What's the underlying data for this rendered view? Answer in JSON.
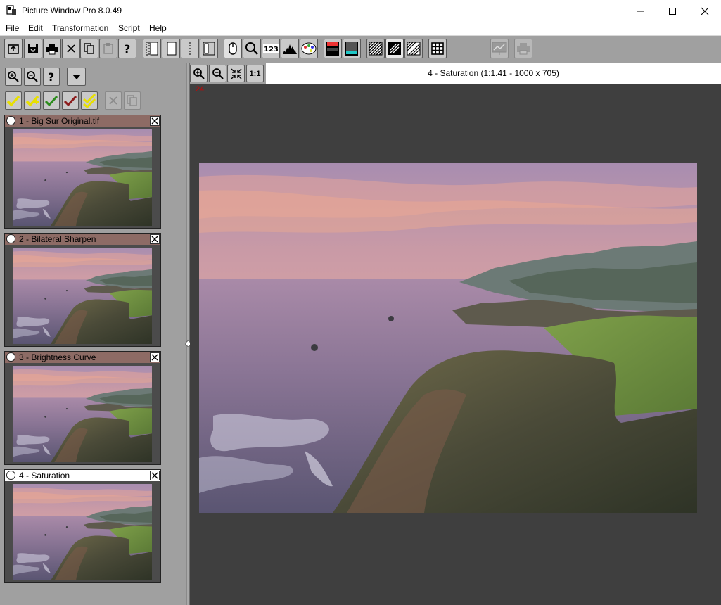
{
  "window": {
    "title": "Picture Window Pro 8.0.49",
    "controls": [
      "minimize",
      "maximize",
      "close"
    ]
  },
  "menu": {
    "items": [
      "File",
      "Edit",
      "Transformation",
      "Script",
      "Help"
    ]
  },
  "toolbar": {
    "buttons": [
      "open-icon",
      "save-icon",
      "print-icon",
      "close-icon",
      "copy-icon",
      "paste-icon",
      "help-icon",
      "panel-layout-1-icon",
      "panel-layout-2-icon",
      "panel-layout-3-icon",
      "panel-layout-4-icon",
      "mouse-mode-icon",
      "magnify-icon",
      "numeric-readout-icon",
      "histogram-icon",
      "palette-icon",
      "color-ramp-icon",
      "gradient-ramp-icon",
      "mask-overlay-1-icon",
      "mask-overlay-2-icon",
      "mask-overlay-3-icon",
      "grid-icon",
      "slideshow-icon",
      "print-preview-icon"
    ]
  },
  "left_panel": {
    "tools": [
      "zoom-in-icon",
      "zoom-out-icon",
      "help-icon",
      "dropdown-icon"
    ],
    "actions": [
      "check-yellow-icon",
      "check-add-icon",
      "check-green-icon",
      "check-red-icon",
      "check-double-icon",
      "delete-icon",
      "duplicate-icon"
    ],
    "thumbnails": [
      {
        "label": "1 - Big Sur Original.tif",
        "active": false
      },
      {
        "label": "2 - Bilateral Sharpen",
        "active": false
      },
      {
        "label": "3 - Brightness Curve",
        "active": false
      },
      {
        "label": "4 - Saturation",
        "active": true
      }
    ]
  },
  "view": {
    "zoom_buttons": [
      "zoom-in-icon",
      "zoom-out-icon",
      "fit-icon"
    ],
    "one_to_one": "1:1",
    "title": "4 - Saturation (1:1.41 - 1000 x 705)",
    "ruler_marker": "24"
  },
  "colors": {
    "panel_gray": "#a0a0a0",
    "canvas_gray": "#3f3f3f",
    "thumb_header": "#8d6b65",
    "active_header": "#ffffff"
  }
}
